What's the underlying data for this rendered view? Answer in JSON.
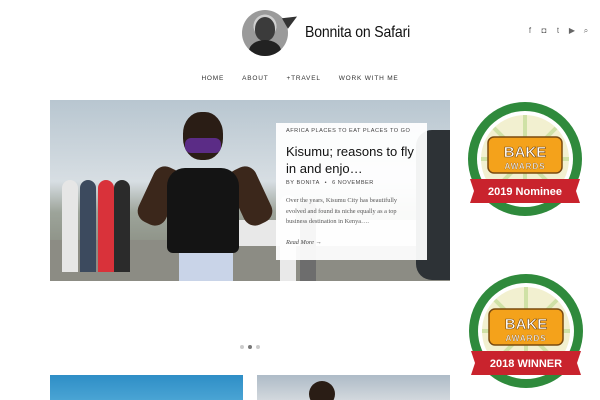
{
  "site": {
    "title": "Bonnita on Safari"
  },
  "social": [
    {
      "icon": "facebook-icon",
      "glyph": "f"
    },
    {
      "icon": "instagram-icon",
      "glyph": "◘"
    },
    {
      "icon": "twitter-icon",
      "glyph": "t"
    },
    {
      "icon": "youtube-icon",
      "glyph": "▶"
    },
    {
      "icon": "search-icon",
      "glyph": "⌕"
    }
  ],
  "nav": {
    "home": "HOME",
    "about": "ABOUT",
    "travel": "+TRAVEL",
    "work": "WORK WITH ME"
  },
  "hero": {
    "categories": "AFRICA PLACES TO EAT PLACES TO GO",
    "title": "Kisumu; reasons to fly in and enjo…",
    "meta_by": "BY",
    "author": "BONITA",
    "date": "6 NOVEMBER",
    "excerpt": "Over the years, Kisumu City has beautifully evolved and found its niche equally as a top business destination in Kenya….",
    "read_more": "Read More →",
    "slide_count": 3,
    "active_slide": 2
  },
  "badges": [
    {
      "brand": "BAKE",
      "sub": "AWARDS",
      "ribbon": "2019 Nominee"
    },
    {
      "brand": "BAKE",
      "sub": "AWARDS",
      "ribbon": "2018 WINNER"
    }
  ],
  "colors": {
    "badge_green": "#2f8a3c",
    "badge_orange": "#f4a21b",
    "ribbon_red": "#c9232d",
    "mask_purple": "#5b2c86"
  }
}
